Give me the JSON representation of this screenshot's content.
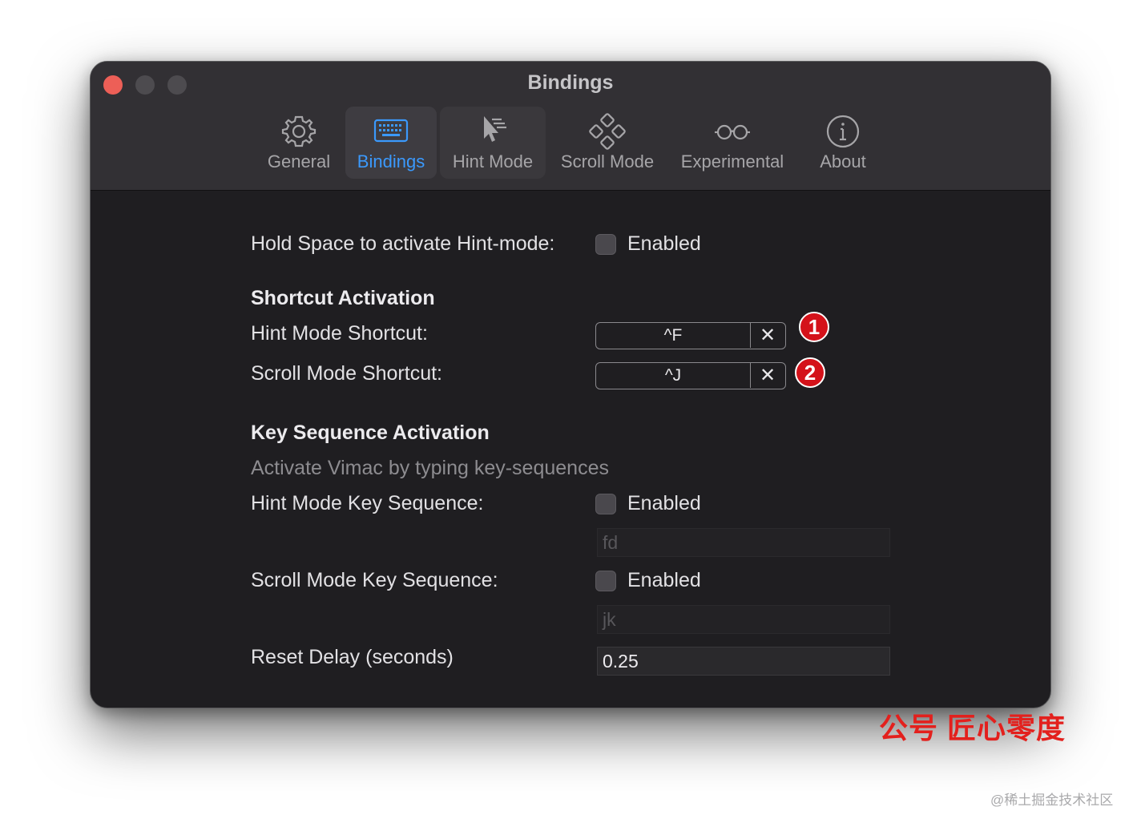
{
  "window": {
    "title": "Bindings"
  },
  "tabs": [
    {
      "label": "General",
      "icon": "gear-icon"
    },
    {
      "label": "Bindings",
      "icon": "keyboard-icon",
      "selected": true
    },
    {
      "label": "Hint Mode",
      "icon": "cursor-icon"
    },
    {
      "label": "Scroll Mode",
      "icon": "scroll-mode-icon"
    },
    {
      "label": "Experimental",
      "icon": "glasses-icon"
    },
    {
      "label": "About",
      "icon": "info-icon"
    }
  ],
  "hold_space": {
    "label": "Hold Space to activate Hint-mode:",
    "checkbox_label": "Enabled",
    "checked": false
  },
  "shortcut_section": {
    "heading": "Shortcut Activation",
    "hint": {
      "label": "Hint Mode Shortcut:",
      "value": "^F",
      "clear": "✕",
      "badge": "1"
    },
    "scroll": {
      "label": "Scroll Mode Shortcut:",
      "value": "^J",
      "clear": "✕",
      "badge": "2"
    }
  },
  "sequence_section": {
    "heading": "Key Sequence Activation",
    "description": "Activate Vimac by typing key-sequences",
    "hint": {
      "label": "Hint Mode Key Sequence:",
      "checkbox_label": "Enabled",
      "checked": false,
      "value": "fd"
    },
    "scroll": {
      "label": "Scroll Mode Key Sequence:",
      "checkbox_label": "Enabled",
      "checked": false,
      "value": "jk"
    },
    "reset_delay": {
      "label": "Reset Delay (seconds)",
      "value": "0.25"
    }
  },
  "watermarks": {
    "red": "公号  匠心零度",
    "grey": "@稀土掘金技术社区"
  },
  "colors": {
    "accent": "#3b99fc",
    "badge": "#d4121a",
    "close": "#ed5f57"
  }
}
